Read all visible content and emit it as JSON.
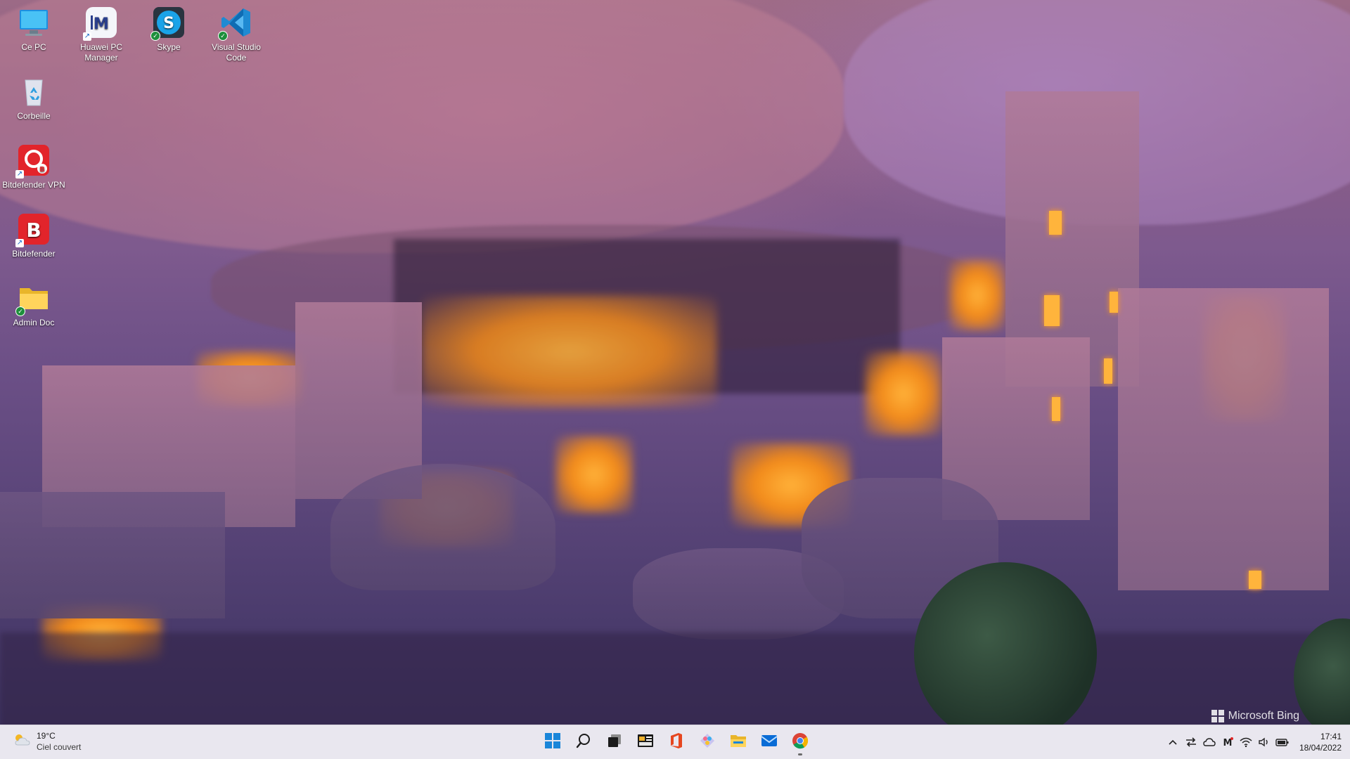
{
  "desktop": {
    "icons": [
      {
        "label": "Ce PC",
        "icon": "computer-icon"
      },
      {
        "label": "Huawei PC Manager",
        "icon": "huawei-pc-manager-icon"
      },
      {
        "label": "Skype",
        "icon": "skype-icon"
      },
      {
        "label": "Visual Studio Code",
        "icon": "vscode-icon"
      },
      {
        "label": "Corbeille",
        "icon": "recycle-bin-icon"
      },
      {
        "label": "Bitdefender VPN",
        "icon": "bitdefender-vpn-icon"
      },
      {
        "label": "Bitdefender",
        "icon": "bitdefender-icon"
      },
      {
        "label": "Admin Doc",
        "icon": "folder-icon"
      }
    ],
    "watermark": "Microsoft Bing"
  },
  "taskbar": {
    "weather": {
      "temperature": "19°C",
      "condition": "Ciel couvert",
      "icon": "partly-cloudy-icon"
    },
    "pinned": [
      {
        "name": "start",
        "icon": "windows-start-icon"
      },
      {
        "name": "search",
        "icon": "search-icon"
      },
      {
        "name": "task-view",
        "icon": "task-view-icon"
      },
      {
        "name": "widgets",
        "icon": "widgets-icon"
      },
      {
        "name": "office",
        "icon": "office-icon"
      },
      {
        "name": "paint",
        "icon": "paint-icon"
      },
      {
        "name": "file-explorer",
        "icon": "folder-icon"
      },
      {
        "name": "mail",
        "icon": "mail-icon"
      },
      {
        "name": "chrome",
        "icon": "chrome-icon"
      }
    ],
    "tray": [
      "chevron-up-icon",
      "network-transfer-icon",
      "onedrive-icon",
      "huawei-icon",
      "wifi-icon",
      "volume-icon",
      "battery-icon"
    ],
    "clock": {
      "time": "17:41",
      "date": "18/04/2022"
    }
  },
  "colors": {
    "taskbar_bg": "#e8e6ee",
    "accent": "#0a6cd6"
  }
}
